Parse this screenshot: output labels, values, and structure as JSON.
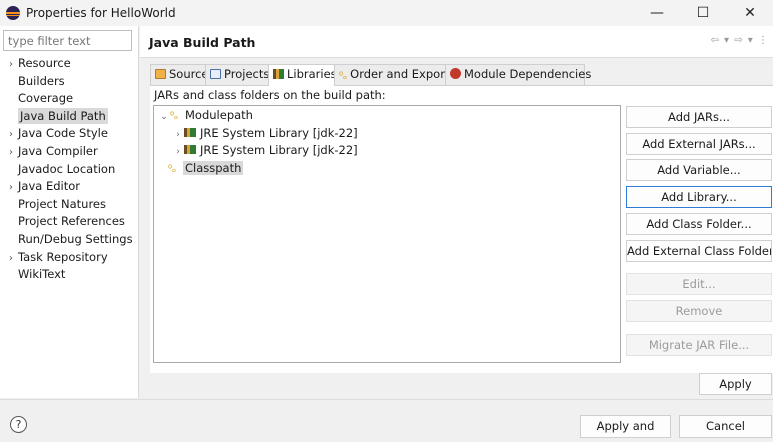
{
  "window": {
    "title": "Properties for HelloWorld",
    "minimize": "—",
    "maximize": "☐",
    "close": "✕"
  },
  "filter": {
    "placeholder": "type filter text"
  },
  "categories": [
    {
      "label": "Resource",
      "expandable": true
    },
    {
      "label": "Builders",
      "expandable": false
    },
    {
      "label": "Coverage",
      "expandable": false
    },
    {
      "label": "Java Build Path",
      "expandable": false,
      "selected": true
    },
    {
      "label": "Java Code Style",
      "expandable": true
    },
    {
      "label": "Java Compiler",
      "expandable": true
    },
    {
      "label": "Javadoc Location",
      "expandable": false
    },
    {
      "label": "Java Editor",
      "expandable": true
    },
    {
      "label": "Project Natures",
      "expandable": false
    },
    {
      "label": "Project References",
      "expandable": false
    },
    {
      "label": "Run/Debug Settings",
      "expandable": false
    },
    {
      "label": "Task Repository",
      "expandable": true
    },
    {
      "label": "WikiText",
      "expandable": false
    }
  ],
  "page": {
    "title": "Java Build Path",
    "nav": "⇦ ▾ ⇨ ▾ ⋮"
  },
  "tabs": [
    {
      "label": "Source",
      "icon": "source-folder-icon"
    },
    {
      "label": "Projects",
      "icon": "projects-icon"
    },
    {
      "label": "Libraries",
      "icon": "libraries-icon",
      "active": true
    },
    {
      "label": "Order and Export",
      "icon": "order-export-icon"
    },
    {
      "label": "Module Dependencies",
      "icon": "module-dependencies-icon"
    }
  ],
  "libraries": {
    "section_label": "JARs and class folders on the build path:",
    "tree": [
      {
        "label": "Modulepath",
        "twisty": "⌄",
        "icon": "modulepath-icon"
      },
      {
        "label": "JRE System Library [jdk-22]",
        "twisty": "›",
        "icon": "jre-library-icon"
      },
      {
        "label": "JRE System Library [jdk-22]",
        "twisty": "›",
        "icon": "jre-library-icon"
      },
      {
        "label": "Classpath",
        "twisty": "",
        "icon": "classpath-icon",
        "selected": true
      }
    ],
    "buttons": [
      {
        "label": "Add JARs...",
        "enabled": true
      },
      {
        "label": "Add External JARs...",
        "enabled": true
      },
      {
        "label": "Add Variable...",
        "enabled": true
      },
      {
        "label": "Add Library...",
        "enabled": true,
        "focused": true
      },
      {
        "label": "Add Class Folder...",
        "enabled": true
      },
      {
        "label": "Add External Class Folder...",
        "enabled": true
      },
      {
        "label": "Edit...",
        "enabled": false
      },
      {
        "label": "Remove",
        "enabled": false
      },
      {
        "label": "Migrate JAR File...",
        "enabled": false
      }
    ]
  },
  "apply": "Apply",
  "footer": {
    "help": "?",
    "apply_and_close": "Apply and Close",
    "cancel": "Cancel"
  },
  "colors": {
    "selection": "#d9d9d9",
    "focus_border": "#2f7bd5",
    "disabled_text": "#9b9b9b"
  }
}
